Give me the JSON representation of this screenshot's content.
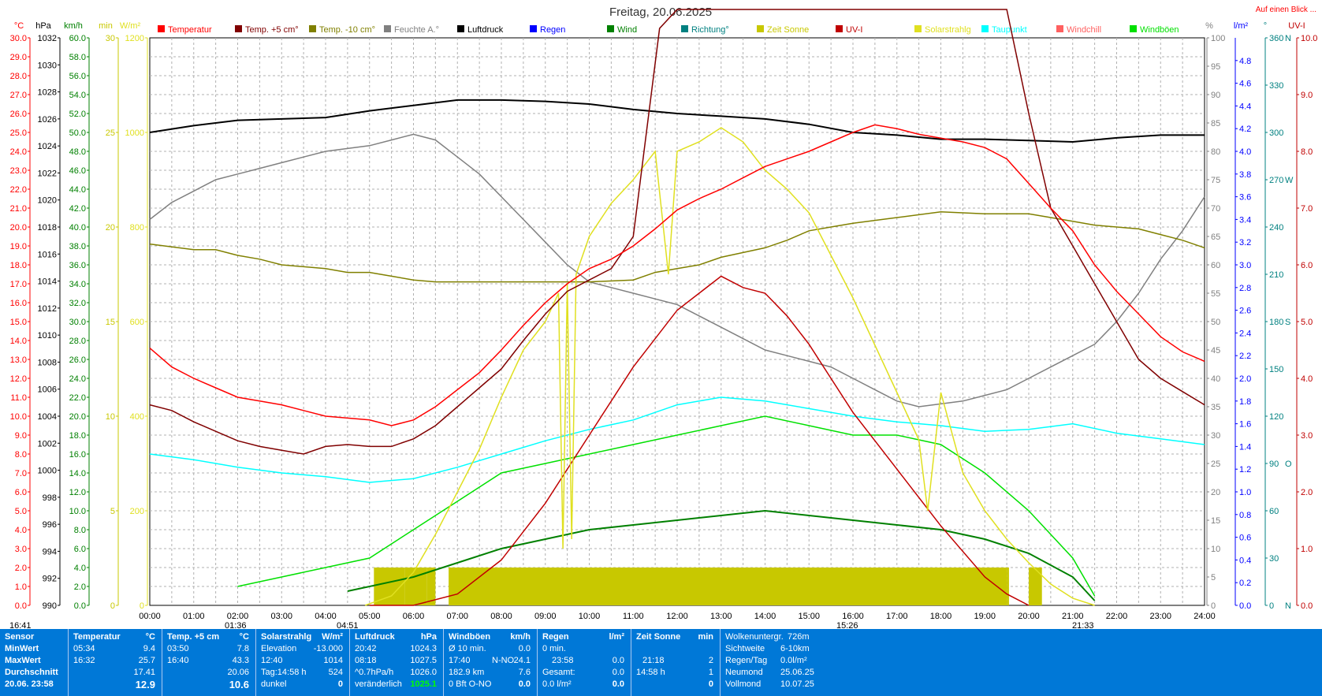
{
  "header": {
    "title": "Freitag, 20.06.2025",
    "link": "Auf einen Blick ...",
    "legend": [
      {
        "label": "Temperatur",
        "color": "#ff0000"
      },
      {
        "label": "Temp. +5 cm°",
        "color": "#800000"
      },
      {
        "label": "Temp. -10 cm°",
        "color": "#808000"
      },
      {
        "label": "Feuchte A.°",
        "color": "#808080"
      },
      {
        "label": "Luftdruck",
        "color": "#000000"
      },
      {
        "label": "Regen",
        "color": "#0000ff"
      },
      {
        "label": "Wind",
        "color": "#008000"
      },
      {
        "label": "Richtung°",
        "color": "#008080"
      },
      {
        "label": "Zeit Sonne",
        "color": "#c8c800"
      },
      {
        "label": "UV-I",
        "color": "#c00000"
      },
      {
        "label": "Solarstrahlg",
        "color": "#e0e020"
      },
      {
        "label": "Taupunkt",
        "color": "#00ffff"
      },
      {
        "label": "Windchill",
        "color": "#ff6060"
      },
      {
        "label": "Windböen",
        "color": "#00e000"
      }
    ]
  },
  "axes": {
    "left_units": [
      "°C",
      "hPa",
      "km/h",
      "min",
      "W/m²"
    ],
    "right_units": [
      "%",
      "l/m²",
      "°",
      "UV-I"
    ],
    "temp_ticks": [
      "0.0",
      "1.0",
      "2.0",
      "3.0",
      "4.0",
      "5.0",
      "6.0",
      "7.0",
      "8.0",
      "9.0",
      "10.0",
      "11.0",
      "12.0",
      "13.0",
      "14.0",
      "15.0",
      "16.0",
      "17.0",
      "18.0",
      "19.0",
      "20.0",
      "21.0",
      "22.0",
      "23.0",
      "24.0",
      "25.0",
      "26.0",
      "27.0",
      "28.0",
      "29.0",
      "30.0"
    ],
    "hpa_ticks": [
      "990",
      "992",
      "994",
      "996",
      "998",
      "1000",
      "1002",
      "1004",
      "1006",
      "1008",
      "1010",
      "1012",
      "1014",
      "1016",
      "1018",
      "1020",
      "1022",
      "1024",
      "1026",
      "1028",
      "1030",
      "1032"
    ],
    "kmh_ticks": [
      "0.0",
      "2.0",
      "4.0",
      "6.0",
      "8.0",
      "10.0",
      "12.0",
      "14.0",
      "16.0",
      "18.0",
      "20.0",
      "22.0",
      "24.0",
      "26.0",
      "28.0",
      "30.0",
      "32.0",
      "34.0",
      "36.0",
      "38.0",
      "40.0",
      "42.0",
      "44.0",
      "46.0",
      "48.0",
      "50.0",
      "52.0",
      "54.0",
      "56.0",
      "58.0",
      "60.0"
    ],
    "min_ticks": [
      "0",
      "5",
      "10",
      "15",
      "20",
      "25",
      "30"
    ],
    "wm2_ticks": [
      "0",
      "200",
      "400",
      "600",
      "800",
      "1000",
      "1200"
    ],
    "pct_ticks": [
      "0",
      "5",
      "10",
      "15",
      "20",
      "25",
      "30",
      "35",
      "40",
      "45",
      "50",
      "55",
      "60",
      "65",
      "70",
      "75",
      "80",
      "85",
      "90",
      "95",
      "100"
    ],
    "lm2_ticks": [
      "0.0",
      "0.2",
      "0.4",
      "0.6",
      "0.8",
      "1.0",
      "1.2",
      "1.4",
      "1.6",
      "1.8",
      "2.0",
      "2.2",
      "2.4",
      "2.6",
      "2.8",
      "3.0",
      "3.2",
      "3.4",
      "3.6",
      "3.8",
      "4.0",
      "4.2",
      "4.4",
      "4.6",
      "4.8"
    ],
    "dir_ticks": [
      "0",
      "30",
      "60",
      "90",
      "120",
      "150",
      "180",
      "210",
      "240",
      "270",
      "300",
      "330",
      "360"
    ],
    "dir_letters": [
      "N",
      "",
      "",
      "O",
      "",
      "",
      "S",
      "",
      "",
      "W",
      "",
      "",
      "N"
    ],
    "uv_ticks": [
      "0.0",
      "1.0",
      "2.0",
      "3.0",
      "4.0",
      "5.0",
      "6.0",
      "7.0",
      "8.0",
      "9.0",
      "10.0"
    ],
    "time_ticks": [
      "00:00",
      "01:00",
      "02:00",
      "03:00",
      "04:00",
      "05:00",
      "06:00",
      "07:00",
      "08:00",
      "09:00",
      "10:00",
      "11:00",
      "12:00",
      "13:00",
      "14:00",
      "15:00",
      "16:00",
      "17:00",
      "18:00",
      "19:00",
      "20:00",
      "21:00",
      "22:00",
      "23:00",
      "24:00"
    ]
  },
  "markers": {
    "now": "16:41",
    "moonrise": "01:36",
    "sunrise": "04:51",
    "moonset": "15:26",
    "sunset": "21:33"
  },
  "panel": {
    "sensor": {
      "head": "Sensor",
      "rows": [
        "MinWert",
        "MaxWert",
        "Durchschnitt",
        "20.06. 23:58"
      ]
    },
    "temp": {
      "head": "Temperatur",
      "unit": "°C",
      "min_time": "05:34",
      "min_val": "9.4",
      "max_time": "16:32",
      "max_val": "25.7",
      "avg": "17.41",
      "now": "12.9"
    },
    "temp5": {
      "head": "Temp. +5 cm",
      "unit": "°C",
      "min_time": "03:50",
      "min_val": "7.8",
      "max_time": "16:40",
      "max_val": "43.3",
      "avg": "20.06",
      "now": "10.6"
    },
    "solar": {
      "head": "Solarstrahlg",
      "unit": "W/m²",
      "r1a": "Elevation",
      "r1b": "-13.000",
      "r2a": "12:40",
      "r2b": "1014",
      "r3a": "Tag:14:58 h",
      "r3b": "524",
      "r4a": "dunkel",
      "r4b": "0"
    },
    "press": {
      "head": "Luftdruck",
      "unit": "hPa",
      "r1a": "20:42",
      "r1b": "1024.3",
      "r2a": "08:18",
      "r2b": "1027.5",
      "r3a": "^0.7hPa/h",
      "r3b": "1026.0",
      "r4a": "veränderlich",
      "r4b": "1025.1"
    },
    "gust": {
      "head": "Windböen",
      "unit": "km/h",
      "r1a": "Ø 10 min.",
      "r1b": "0.0",
      "r2a": "17:40",
      "r2m": "N-NO",
      "r2b": "24.1",
      "r3a": "182.9 km",
      "r3b": "7.6",
      "r4a": "0 Bft O-NO",
      "r4b": "0.0"
    },
    "rain": {
      "head": "Regen",
      "unit": "l/m²",
      "r1a": "0 min.",
      "r1b": "",
      "r2a": "23:58",
      "r2b": "0.0",
      "r3a": "Gesamt:",
      "r3b": "0.0",
      "r4a": "0.0 l/m²",
      "r4b": "0.0"
    },
    "sun": {
      "head": "Zeit Sonne",
      "unit": "min",
      "r1a": "",
      "r1b": "",
      "r2a": "21:18",
      "r2b": "2",
      "r3a": "14:58 h",
      "r3b": "1",
      "r4a": "",
      "r4b": "0"
    },
    "info": {
      "r0a": "Wolkenuntergr.",
      "r0b": "726m",
      "r1a": "Sichtweite",
      "r1b": "6-10km",
      "r2a": "Regen/Tag",
      "r2b": "0.0l/m²",
      "r3a": "Neumond",
      "r3b": "25.06.25",
      "r4a": "Vollmond",
      "r4b": "10.07.25"
    }
  },
  "chart_data": {
    "type": "line",
    "x_unit": "hours",
    "x_range": [
      0,
      24
    ],
    "series": [
      {
        "name": "Temperatur",
        "unit": "°C",
        "color": "#ff0000",
        "x": [
          0,
          0.5,
          1,
          1.5,
          2,
          2.5,
          3,
          3.5,
          4,
          4.5,
          5,
          5.5,
          6,
          6.5,
          7,
          7.5,
          8,
          8.5,
          9,
          9.5,
          10,
          10.5,
          11,
          11.5,
          12,
          12.5,
          13,
          13.5,
          14,
          14.5,
          15,
          15.5,
          16,
          16.5,
          17,
          17.5,
          18,
          18.5,
          19,
          19.5,
          20,
          20.5,
          21,
          21.5,
          22,
          22.5,
          23,
          23.5,
          24
        ],
        "y": [
          13.6,
          12.6,
          12.0,
          11.5,
          11.0,
          10.8,
          10.6,
          10.3,
          10.0,
          9.9,
          9.8,
          9.5,
          9.8,
          10.5,
          11.4,
          12.3,
          13.5,
          14.8,
          16.0,
          17.0,
          17.8,
          18.3,
          19.0,
          19.9,
          20.9,
          21.5,
          22.0,
          22.6,
          23.2,
          23.6,
          24.0,
          24.5,
          25.0,
          25.4,
          25.2,
          24.9,
          24.7,
          24.5,
          24.2,
          23.6,
          22.3,
          21.0,
          19.8,
          18.0,
          16.6,
          15.4,
          14.2,
          13.4,
          12.9
        ]
      },
      {
        "name": "Temp. +5 cm°",
        "unit": "°C",
        "color": "#800000",
        "x": [
          0,
          0.5,
          1,
          1.5,
          2,
          2.5,
          3,
          3.5,
          4,
          4.5,
          5,
          5.5,
          6,
          6.5,
          7,
          7.5,
          8,
          8.5,
          9,
          9.5,
          10,
          10.5,
          11,
          11.3,
          11.6,
          12,
          13,
          14,
          15,
          16,
          16.5,
          17,
          17.5,
          18,
          18.5,
          19,
          19.5,
          20,
          20.5,
          21,
          21.5,
          22,
          22.5,
          23,
          23.5,
          24
        ],
        "y": [
          10.6,
          10.3,
          9.7,
          9.2,
          8.7,
          8.4,
          8.2,
          8.0,
          8.4,
          8.5,
          8.4,
          8.4,
          8.8,
          9.5,
          10.5,
          11.5,
          12.5,
          14.0,
          15.4,
          16.6,
          17.2,
          17.8,
          19.5,
          25.0,
          30.5,
          31.5,
          31.5,
          31.5,
          31.5,
          31.5,
          31.5,
          31.5,
          31.5,
          31.5,
          31.5,
          31.5,
          31.5,
          26.0,
          21.0,
          19.0,
          17.0,
          15.0,
          13.0,
          12.0,
          11.3,
          10.6
        ]
      },
      {
        "name": "Temp. -10 cm°",
        "unit": "°C",
        "color": "#808000",
        "x": [
          0,
          1,
          1.5,
          2,
          2.5,
          3,
          4,
          4.5,
          5,
          5.5,
          6,
          6.5,
          7,
          8,
          9,
          10,
          11,
          11.5,
          12,
          12.5,
          13,
          14,
          14.5,
          15,
          15.5,
          16,
          17,
          18,
          19,
          20,
          20.5,
          21,
          21.5,
          22,
          22.5,
          23,
          23.5,
          24
        ],
        "y": [
          19.1,
          18.8,
          18.8,
          18.5,
          18.3,
          18.0,
          17.8,
          17.6,
          17.6,
          17.4,
          17.2,
          17.1,
          17.1,
          17.1,
          17.1,
          17.1,
          17.2,
          17.6,
          17.8,
          18.0,
          18.4,
          18.9,
          19.3,
          19.8,
          20.0,
          20.2,
          20.5,
          20.8,
          20.7,
          20.7,
          20.5,
          20.3,
          20.1,
          20.0,
          19.9,
          19.6,
          19.3,
          18.9
        ]
      },
      {
        "name": "Feuchte A.°",
        "unit": "%",
        "color": "#808080",
        "x": [
          0,
          0.5,
          1,
          1.5,
          2,
          2.5,
          3,
          3.5,
          4,
          4.5,
          5,
          5.5,
          6,
          6.5,
          7,
          7.5,
          8,
          8.5,
          9,
          9.5,
          10,
          10.5,
          11,
          11.5,
          12,
          12.5,
          13,
          13.5,
          14,
          14.5,
          15,
          15.5,
          16,
          16.5,
          17,
          17.5,
          18,
          18.5,
          19,
          19.5,
          20,
          20.5,
          21,
          21.5,
          22,
          22.5,
          23,
          23.5,
          24
        ],
        "y": [
          68,
          71,
          73,
          75,
          76,
          77,
          78,
          79,
          80,
          80.5,
          81,
          82,
          83,
          82,
          79,
          76,
          72,
          68,
          64,
          60,
          57,
          56,
          55,
          54,
          53,
          51,
          49,
          47,
          45,
          44,
          43,
          42,
          40,
          38,
          36,
          35,
          35.5,
          36,
          37,
          38,
          40,
          42,
          44,
          46,
          50,
          55,
          61,
          66,
          72
        ]
      },
      {
        "name": "Luftdruck",
        "unit": "hPa",
        "color": "#000000",
        "x": [
          0,
          1,
          2,
          3,
          4,
          5,
          6,
          7,
          8,
          9,
          10,
          11,
          12,
          13,
          14,
          15,
          16,
          17,
          18,
          19,
          20,
          21,
          22,
          23,
          24
        ],
        "y": [
          1025.0,
          1025.5,
          1025.9,
          1026.0,
          1026.1,
          1026.6,
          1027.0,
          1027.4,
          1027.4,
          1027.3,
          1027.1,
          1026.7,
          1026.4,
          1026.2,
          1026.0,
          1025.6,
          1025.0,
          1024.8,
          1024.5,
          1024.5,
          1024.4,
          1024.3,
          1024.6,
          1024.8,
          1024.8
        ]
      },
      {
        "name": "Taupunkt",
        "unit": "°C",
        "color": "#00ffff",
        "x": [
          0,
          1,
          2,
          3,
          4,
          5,
          6,
          7,
          8,
          9,
          10,
          11,
          12,
          13,
          14,
          15,
          16,
          17,
          18,
          19,
          20,
          21,
          22,
          23,
          24
        ],
        "y": [
          8.0,
          7.7,
          7.3,
          7.0,
          6.8,
          6.5,
          6.7,
          7.3,
          8.0,
          8.7,
          9.3,
          9.8,
          10.6,
          11.0,
          10.8,
          10.4,
          10.0,
          9.7,
          9.5,
          9.2,
          9.3,
          9.6,
          9.1,
          8.8,
          8.5
        ]
      },
      {
        "name": "Solarstrahlg",
        "unit": "W/m²",
        "color": "#e0e020",
        "x": [
          4.9,
          5.5,
          6,
          6.5,
          7,
          7.5,
          8,
          8.5,
          9,
          9.3,
          9.4,
          9.5,
          9.6,
          9.7,
          10,
          10.5,
          11,
          11.5,
          11.8,
          12.0,
          12.5,
          13,
          13.5,
          14,
          14.5,
          15,
          15.5,
          16,
          16.5,
          17,
          17.5,
          17.7,
          18,
          18.5,
          19,
          19.5,
          20,
          20.5,
          21,
          21.5
        ],
        "y": [
          0,
          20,
          70,
          150,
          240,
          330,
          440,
          540,
          600,
          660,
          120,
          680,
          140,
          700,
          780,
          850,
          900,
          960,
          700,
          960,
          980,
          1010,
          980,
          920,
          880,
          830,
          740,
          650,
          550,
          450,
          350,
          200,
          450,
          280,
          200,
          140,
          90,
          45,
          15,
          0
        ]
      },
      {
        "name": "UV-I",
        "unit": "UV-I",
        "color": "#c00000",
        "x": [
          5,
          6,
          7,
          8,
          9,
          10,
          11,
          12,
          12.5,
          13,
          13.5,
          14,
          14.5,
          15,
          15.5,
          16,
          17,
          18,
          19,
          19.5,
          20
        ],
        "y": [
          0,
          0,
          0.2,
          0.8,
          1.8,
          3.0,
          4.2,
          5.2,
          5.5,
          5.8,
          5.6,
          5.5,
          5.1,
          4.6,
          4.0,
          3.4,
          2.4,
          1.4,
          0.5,
          0.2,
          0
        ]
      },
      {
        "name": "Zeit Sonne",
        "unit": "min",
        "color": "#c8c800",
        "x": [
          5.1,
          5.8,
          6.3,
          6.5,
          6.8,
          19.5,
          19.55,
          20.0,
          20.3,
          21.3
        ],
        "y": [
          2,
          2,
          2,
          0,
          2,
          2,
          0,
          2,
          0,
          2
        ]
      },
      {
        "name": "Wind",
        "unit": "km/h",
        "color": "#008000",
        "x": [
          4.5,
          6,
          7,
          8,
          9,
          10,
          11,
          12,
          13,
          14,
          15,
          16,
          17,
          18,
          19,
          20,
          21,
          21.5
        ],
        "y": [
          1.5,
          3.0,
          4.5,
          6.0,
          7.0,
          8.0,
          8.5,
          9.0,
          9.5,
          10.0,
          9.5,
          9.0,
          8.5,
          8.0,
          7.0,
          5.5,
          3.0,
          0.5
        ]
      },
      {
        "name": "Windböen",
        "unit": "km/h",
        "color": "#00e000",
        "x": [
          2,
          3,
          4,
          5,
          6,
          7,
          8,
          9,
          10,
          11,
          12,
          13,
          14,
          15,
          16,
          17,
          18,
          19,
          20,
          21,
          21.5
        ],
        "y": [
          2,
          3,
          4,
          5,
          8,
          11,
          14,
          15,
          16,
          17,
          18,
          19,
          20,
          19,
          18,
          18,
          17,
          14,
          10,
          5,
          1
        ]
      }
    ]
  }
}
